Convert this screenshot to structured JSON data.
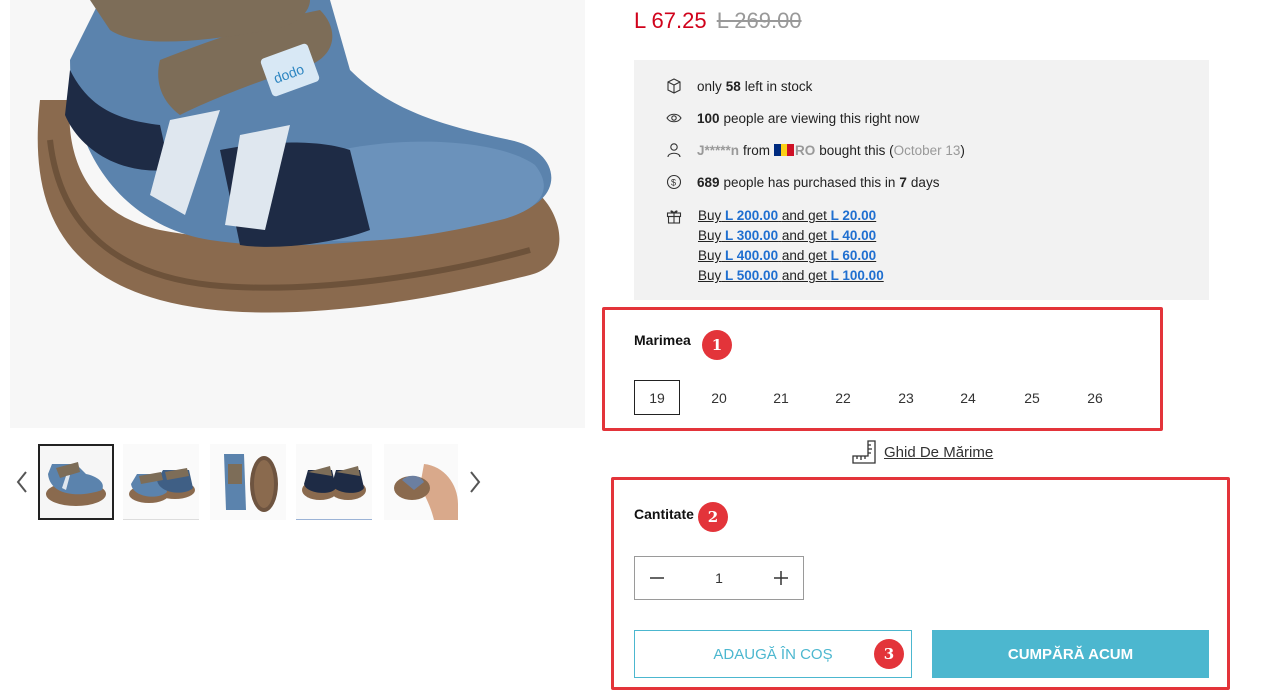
{
  "product": {
    "image_alt": "Blue kids' barefoot sneaker with brown velcro straps",
    "thumbnails": [
      {
        "name": "thumb-side-view"
      },
      {
        "name": "thumb-pair-view"
      },
      {
        "name": "thumb-sole-view"
      },
      {
        "name": "thumb-top-view"
      },
      {
        "name": "thumb-flex-view"
      }
    ]
  },
  "price": {
    "sale": "L 67.25",
    "original": "L 269.00",
    "sale_color": "#d0021b"
  },
  "info": {
    "stock_prefix": "only",
    "stock_count": "58",
    "stock_suffix": "left in stock",
    "viewers_count": "100",
    "viewers_suffix": "people are viewing this right now",
    "buyer_name": "J*****n",
    "buyer_from": "from",
    "buyer_country": "RO",
    "buyer_action": "bought this (",
    "buyer_date": "October 13",
    "buyer_close": ")",
    "purchased_count": "689",
    "purchased_mid": "people has purchased this in",
    "purchased_days": "7",
    "purchased_suffix": "days",
    "offers": [
      {
        "buy": "Buy",
        "spend": "L 200.00",
        "mid": "and get",
        "get": "L 20.00"
      },
      {
        "buy": "Buy",
        "spend": "L 300.00",
        "mid": "and get",
        "get": "L 40.00"
      },
      {
        "buy": "Buy",
        "spend": "L 400.00",
        "mid": "and get",
        "get": "L 60.00"
      },
      {
        "buy": "Buy",
        "spend": "L 500.00",
        "mid": "and get",
        "get": "L 100.00"
      }
    ]
  },
  "size": {
    "label": "Marimea",
    "options": [
      "19",
      "20",
      "21",
      "22",
      "23",
      "24",
      "25",
      "26"
    ],
    "selected": "19",
    "guide_label": "Ghid De Mărime"
  },
  "quantity": {
    "label": "Cantitate",
    "value": "1"
  },
  "actions": {
    "add_to_cart": "ADAUGĂ ÎN COȘ",
    "buy_now": "CUMPĂRĂ ACUM",
    "accent_color": "#4cb7cf"
  },
  "annotations": {
    "one": "1",
    "two": "2",
    "three": "3",
    "color": "#e3343a"
  }
}
